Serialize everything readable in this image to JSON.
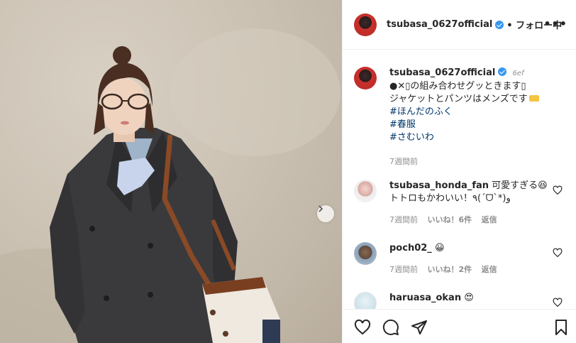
{
  "post": {
    "username": "tsubasa_0627official",
    "follow_label": "• フォロー中",
    "more_label": "•••",
    "caption_username": "tsubasa_0627official",
    "caption_tail": "6ef",
    "caption_line1": "●✕▯の組み合わせグッときます▯",
    "caption_line2": "ジャケットとパンツはメンズです",
    "hashtags": [
      "#ほんだのふく",
      "#春服",
      "#さむいわ"
    ],
    "caption_time": "7週間前"
  },
  "comments": [
    {
      "username": "tsubasa_honda_fan",
      "text_line1": "可愛すぎる😆",
      "text_line2": "トトロもかわいい！٩(ˊᗜˋ*)و",
      "time": "7週間前",
      "likes": "いいね！6件",
      "reply": "返信"
    },
    {
      "username": "poch02_",
      "text_line1": "😀",
      "time": "7週間前",
      "likes": "いいね！2件",
      "reply": "返信"
    },
    {
      "username": "haruasa_okan",
      "text_line1": "😍"
    }
  ],
  "icons": {
    "like": "heart-icon",
    "comment": "comment-icon",
    "share": "share-icon",
    "save": "bookmark-icon",
    "carousel_next": "chevron-right-icon"
  },
  "colors": {
    "link": "#00376b",
    "verified": "#3897f0",
    "muted": "#8e8e8e"
  }
}
